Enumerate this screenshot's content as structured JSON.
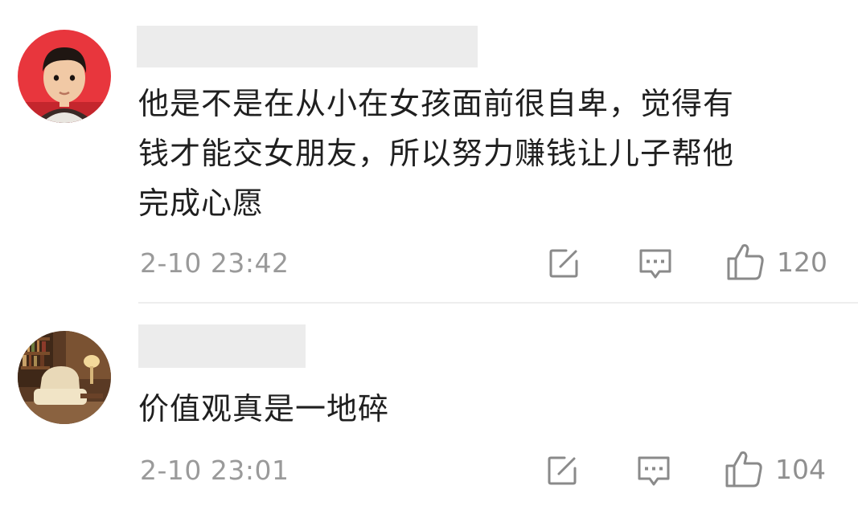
{
  "comments": [
    {
      "avatar": "child-portrait-avatar",
      "text_lines": [
        "他是不是在从小在女孩面前很自卑，觉得有",
        "钱才能交女朋友，所以努力赚钱让儿子帮他",
        "完成心愿"
      ],
      "time": "2-10 23:42",
      "likes": "120",
      "icons": {
        "edit": "edit-icon",
        "reply": "comment-icon",
        "like": "thumbs-up-icon"
      }
    },
    {
      "avatar": "library-room-avatar",
      "text_lines": [
        "价值观真是一地碎"
      ],
      "time": "2-10 23:01",
      "likes": "104",
      "icons": {
        "edit": "edit-icon",
        "reply": "comment-icon",
        "like": "thumbs-up-icon"
      }
    }
  ],
  "colors": {
    "text": "#1f1f1f",
    "meta": "#9a9a9a",
    "icon": "#8a8a8a",
    "placeholder": "#ececec",
    "divider": "#eeeeee"
  }
}
